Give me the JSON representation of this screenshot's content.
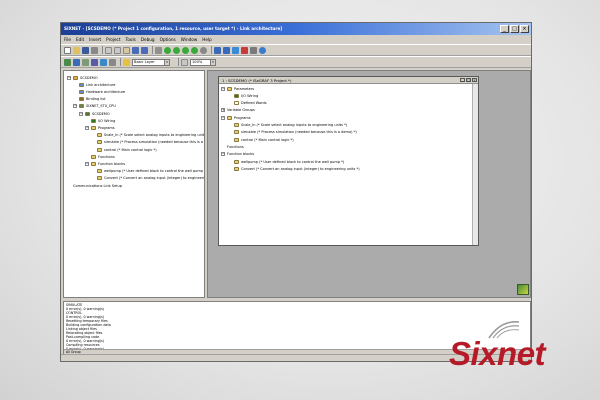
{
  "window": {
    "title": "SIXNET - [SCSDEMO (* Project 1 configuration, 1 resource, user target *) - Link architecture]",
    "controls": [
      "_",
      "□",
      "×"
    ]
  },
  "menu": [
    "File",
    "Edit",
    "Insert",
    "Project",
    "Tools",
    "Debug",
    "Options",
    "Window",
    "Help"
  ],
  "toolbar": {
    "layer_combo": "Basic Layer",
    "zoom_combo": "100%"
  },
  "left_tree": [
    {
      "label": "SCSDEMO",
      "icon": "project-icon",
      "color": "#e0b040",
      "toggle": "−",
      "depth": 0
    },
    {
      "label": "Link architecture",
      "icon": "link-icon",
      "color": "#6688cc",
      "toggle": "",
      "depth": 1
    },
    {
      "label": "Hardware architecture",
      "icon": "hardware-icon",
      "color": "#6688cc",
      "toggle": "",
      "depth": 1
    },
    {
      "label": "Binding list",
      "icon": "binding-icon",
      "color": "#8a6a3a",
      "toggle": "",
      "depth": 1
    },
    {
      "label": "SIXNET_ST0_CPU",
      "icon": "cpu-icon",
      "color": "#5c8a5c",
      "toggle": "−",
      "depth": 1
    },
    {
      "label": "SCSDEMO",
      "icon": "resource-icon",
      "color": "#4a7a4a",
      "toggle": "−",
      "depth": 2
    },
    {
      "label": "I/O Wiring",
      "icon": "io-wiring-icon",
      "color": "#2a7a2a",
      "toggle": "",
      "depth": 3
    },
    {
      "label": "Programs",
      "icon": "folder-icon",
      "color": "#e8d070",
      "toggle": "−",
      "depth": 3
    },
    {
      "label": "Scale_In (* Scale select analog inputs to engineering units *)",
      "icon": "program-icon",
      "color": "#e8d070",
      "toggle": "",
      "depth": 4
    },
    {
      "label": "simulate (* Process simulation (needed because this is a demo) *)",
      "icon": "program-icon",
      "color": "#e8d070",
      "toggle": "",
      "depth": 4
    },
    {
      "label": "control (* Main control logic *)",
      "icon": "program-icon",
      "color": "#e8d070",
      "toggle": "",
      "depth": 4
    },
    {
      "label": "Functions",
      "icon": "folder-icon",
      "color": "#e8d070",
      "toggle": "",
      "depth": 3
    },
    {
      "label": "Function blocks",
      "icon": "folder-icon",
      "color": "#e8d070",
      "toggle": "−",
      "depth": 3
    },
    {
      "label": "wellpump (* User defined block to control the well pump *)",
      "icon": "block-icon",
      "color": "#e8d070",
      "toggle": "",
      "depth": 4
    },
    {
      "label": "Convert (* Convert an analog input (integer) to engineering units *)",
      "icon": "block-icon",
      "color": "#e8d070",
      "toggle": "",
      "depth": 4
    },
    {
      "label": "Communications Link Setup",
      "icon": "",
      "color": "",
      "toggle": "",
      "depth": 0
    }
  ],
  "child_window": {
    "title": "1 : SCSDEMO (* ISaGRAF 3 Project *)",
    "controls": [
      "_",
      "□",
      "×"
    ],
    "tree": [
      {
        "label": "Parameters",
        "icon": "folder-icon",
        "color": "#e8d070",
        "toggle": "−",
        "depth": 0
      },
      {
        "label": "I/O Wiring",
        "icon": "io-wiring-icon",
        "color": "#2a7a2a",
        "toggle": "",
        "depth": 1
      },
      {
        "label": "Defined Words",
        "icon": "words-icon",
        "color": "#ffffff",
        "toggle": "",
        "depth": 1
      },
      {
        "label": "Variable Groups",
        "icon": "",
        "color": "",
        "toggle": "+",
        "depth": 0
      },
      {
        "label": "Programs",
        "icon": "folder-icon",
        "color": "#e8d070",
        "toggle": "−",
        "depth": 0
      },
      {
        "label": "Scale_In (* Scale select analog inputs to engineering units *)",
        "icon": "program-icon",
        "color": "#e8d070",
        "toggle": "",
        "depth": 1
      },
      {
        "label": "simulate (* Process simulation (needed because this is a demo) *)",
        "icon": "program-icon",
        "color": "#e8d070",
        "toggle": "",
        "depth": 1
      },
      {
        "label": "control (* Main control logic *)",
        "icon": "program-icon",
        "color": "#e8d070",
        "toggle": "",
        "depth": 1
      },
      {
        "label": "Functions",
        "icon": "",
        "color": "",
        "toggle": "",
        "depth": 0
      },
      {
        "label": "Function blocks",
        "icon": "",
        "color": "",
        "toggle": "−",
        "depth": 0
      },
      {
        "label": "wellpump (* User defined block to control the well pump *)",
        "icon": "block-icon",
        "color": "#e8d070",
        "toggle": "",
        "depth": 1
      },
      {
        "label": "Convert (* Convert an analog input (integer) to engineering units *)",
        "icon": "block-icon",
        "color": "#e8d070",
        "toggle": "",
        "depth": 1
      }
    ]
  },
  "output": {
    "lines": [
      "SIMULATE",
      "0 error(s), 0 warning(s)",
      "CONTROL",
      "0 error(s), 0 warning(s)",
      "Resetting temporary files",
      "Building configuration data",
      "Linking object files",
      "Relocating object files",
      "Post-compiling code",
      "0 error(s), 0 warning(s)",
      "Compiling resources",
      "0 error(s), 0 warning(s)",
      "SCSDEMO - 0 error(s), 0 warning(s)"
    ],
    "tab": "All Group"
  },
  "brand": {
    "logo_text": "Sixnet",
    "logo_color": "#b61a28"
  }
}
